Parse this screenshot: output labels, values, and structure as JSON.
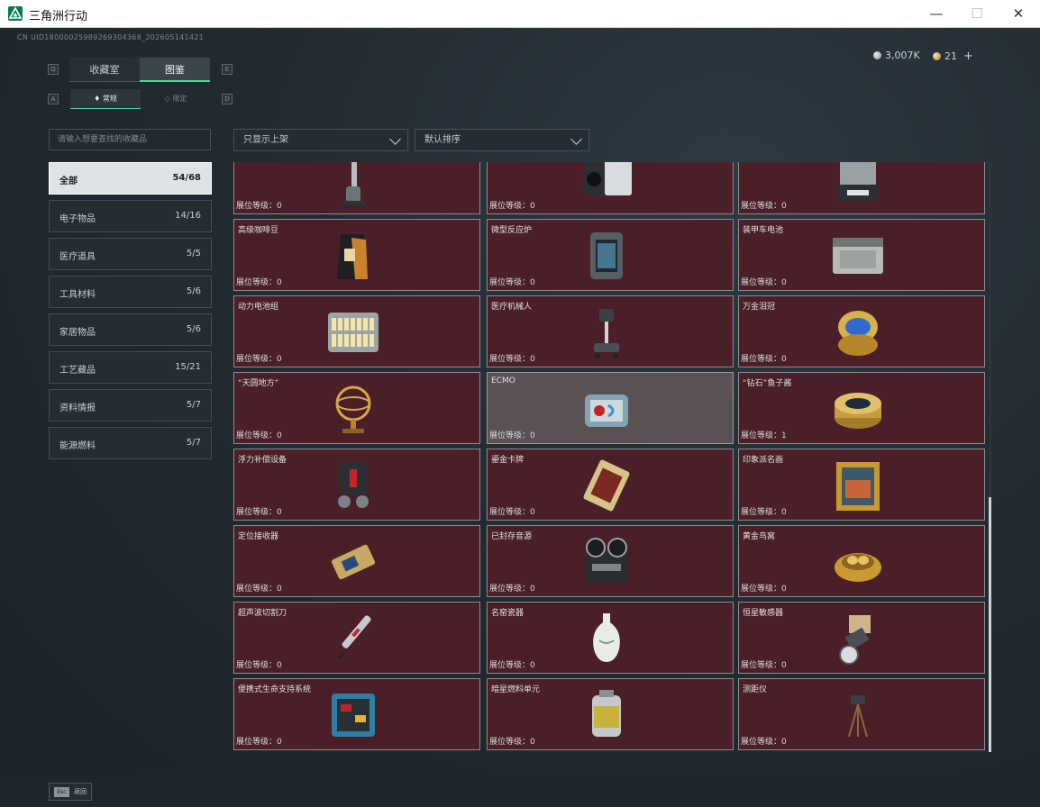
{
  "window": {
    "title": "三角洲行动",
    "minimize": "—",
    "maximize": "☐",
    "close": "✕"
  },
  "header": {
    "uid": "CN UID1800002598926930436​8_20260514142​1",
    "currency_silver": "3,007K",
    "currency_gold": "21",
    "currency_add": "+"
  },
  "tabs": {
    "key_left": "Q",
    "key_right": "E",
    "items": [
      {
        "label": "收藏室",
        "active": false
      },
      {
        "label": "图鉴",
        "active": true
      }
    ]
  },
  "subtabs": {
    "key_left": "A",
    "key_right": "D",
    "items": [
      {
        "label": "常规",
        "active": true
      },
      {
        "label": "限定",
        "active": false
      }
    ]
  },
  "search": {
    "placeholder": "请输入想要查找的收藏品"
  },
  "categories": [
    {
      "label": "全部",
      "count": "54/68",
      "active": true
    },
    {
      "label": "电子物品",
      "count": "14/16"
    },
    {
      "label": "医疗道具",
      "count": "5/5"
    },
    {
      "label": "工具材料",
      "count": "5/6"
    },
    {
      "label": "家居物品",
      "count": "5/6"
    },
    {
      "label": "工艺藏品",
      "count": "15/21"
    },
    {
      "label": "资料情报",
      "count": "5/7"
    },
    {
      "label": "能源燃料",
      "count": "5/7"
    }
  ],
  "filters": {
    "shelf": "只显示上架",
    "sort": "默认排序"
  },
  "level_label": "展位等级：",
  "items": [
    {
      "name": "",
      "level": "0",
      "icon": "vacuum-cleaner-icon"
    },
    {
      "name": "",
      "level": "0",
      "icon": "camera-equipment-icon"
    },
    {
      "name": "",
      "level": "0",
      "icon": "printer-device-icon"
    },
    {
      "name": "高级咖啡豆",
      "level": "0",
      "icon": "coffee-bag-icon"
    },
    {
      "name": "微型反应炉",
      "level": "0",
      "icon": "micro-reactor-icon"
    },
    {
      "name": "装甲车电池",
      "level": "0",
      "icon": "vehicle-battery-icon"
    },
    {
      "name": "动力电池组",
      "level": "0",
      "icon": "battery-pack-icon"
    },
    {
      "name": "医疗机械人",
      "level": "0",
      "icon": "medical-robot-icon"
    },
    {
      "name": "万金泪冠",
      "level": "0",
      "icon": "jeweled-egg-icon"
    },
    {
      "name": "“天圆地方”",
      "level": "0",
      "icon": "armillary-sphere-icon"
    },
    {
      "name": "ECMO",
      "level": "0",
      "icon": "ecmo-machine-icon",
      "selected": true
    },
    {
      "name": "“钻石”鱼子酱",
      "level": "1",
      "icon": "caviar-tin-icon"
    },
    {
      "name": "浮力补偿设备",
      "level": "0",
      "icon": "buoyancy-device-icon"
    },
    {
      "name": "鎏金卡牌",
      "level": "0",
      "icon": "gilded-card-icon"
    },
    {
      "name": "印象派名画",
      "level": "0",
      "icon": "framed-painting-icon"
    },
    {
      "name": "定位接收器",
      "level": "0",
      "icon": "gps-receiver-icon"
    },
    {
      "name": "已封存音源",
      "level": "0",
      "icon": "reel-recorder-icon"
    },
    {
      "name": "黄金鸟窝",
      "level": "0",
      "icon": "golden-nest-icon"
    },
    {
      "name": "超声波切割刀",
      "level": "0",
      "icon": "ultrasonic-cutter-icon"
    },
    {
      "name": "名窑瓷器",
      "level": "0",
      "icon": "porcelain-vase-icon"
    },
    {
      "name": "恒星敏感器",
      "level": "0",
      "icon": "star-sensor-icon"
    },
    {
      "name": "便携式生命支持系统",
      "level": "0",
      "icon": "life-support-icon"
    },
    {
      "name": "暗星燃料单元",
      "level": "0",
      "icon": "fuel-cell-icon"
    },
    {
      "name": "测距仪",
      "level": "0",
      "icon": "rangefinder-icon"
    }
  ],
  "footer": {
    "esc_key": "Esc",
    "back": "返回"
  },
  "colors": {
    "card_bg": "#4a1f27",
    "card_selected_bg": "#5a5152",
    "accent_green": "#4fd49a"
  }
}
